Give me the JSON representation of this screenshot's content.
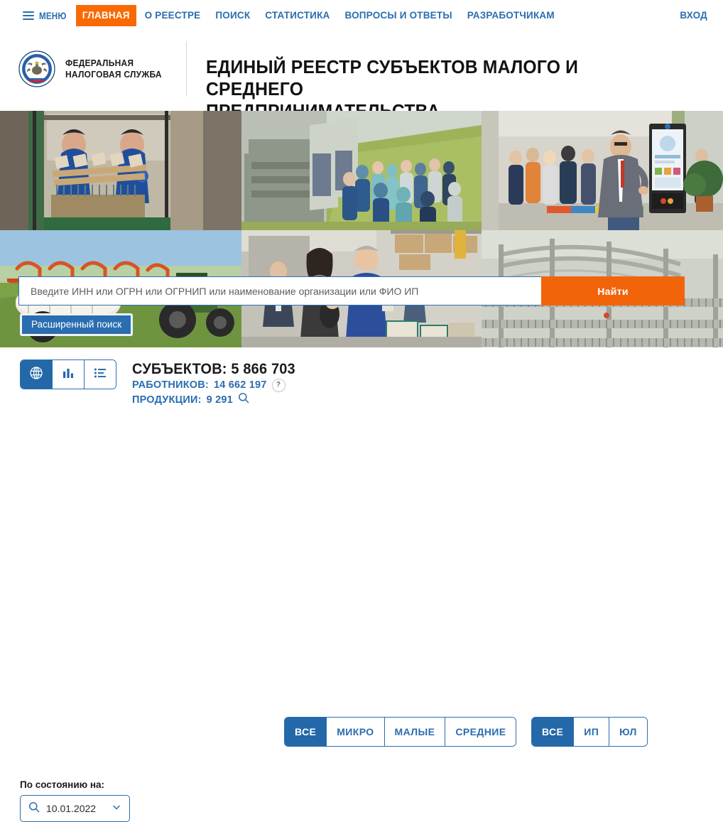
{
  "nav": {
    "menu_label": "МЕНЮ",
    "items": [
      {
        "label": "ГЛАВНАЯ",
        "active": true
      },
      {
        "label": "О РЕЕСТРЕ",
        "active": false
      },
      {
        "label": "ПОИСК",
        "active": false
      },
      {
        "label": "СТАТИСТИКА",
        "active": false
      },
      {
        "label": "ВОПРОСЫ И ОТВЕТЫ",
        "active": false
      },
      {
        "label": "РАЗРАБОТЧИКАМ",
        "active": false
      }
    ],
    "login_label": "ВХОД",
    "accent_active": "#f96a05",
    "link_color": "#2a6db0"
  },
  "brand": {
    "agency_name": "ФЕДЕРАЛЬНАЯ\nНАЛОГОВАЯ СЛУЖБА",
    "title": "ЕДИНЫЙ РЕЕСТР СУБЪЕКТОВ МАЛОГО И СРЕДНЕГО\nПРЕДПРИНИМАТЕЛЬСТВА"
  },
  "search": {
    "placeholder": "Введите ИНН или ОГРН или ОГРНИП или наименование организации или ФИО ИП",
    "value": "",
    "button_label": "Найти",
    "button_color": "#f2640a",
    "advanced_label": "Расширенный поиск"
  },
  "view_modes": [
    {
      "icon": "globe-icon",
      "active": true
    },
    {
      "icon": "bar-chart-icon",
      "active": false
    },
    {
      "icon": "list-icon",
      "active": false
    }
  ],
  "stats": {
    "subjects_label": "СУБЪЕКТОВ:",
    "subjects_value": "5 866 703",
    "workers_label": "РАБОТНИКОВ:",
    "workers_value": "14 662 197",
    "workers_help": "?",
    "products_label": "ПРОДУКЦИИ:",
    "products_value": "9 291"
  },
  "size_filter": {
    "options": [
      {
        "label": "ВСЕ",
        "active": true
      },
      {
        "label": "МИКРО",
        "active": false
      },
      {
        "label": "МАЛЫЕ",
        "active": false
      },
      {
        "label": "СРЕДНИЕ",
        "active": false
      }
    ]
  },
  "type_filter": {
    "options": [
      {
        "label": "ВСЕ",
        "active": true
      },
      {
        "label": "ИП",
        "active": false
      },
      {
        "label": "ЮЛ",
        "active": false
      }
    ]
  },
  "date_picker": {
    "label": "По состоянию на:",
    "value": "10.01.2022"
  }
}
